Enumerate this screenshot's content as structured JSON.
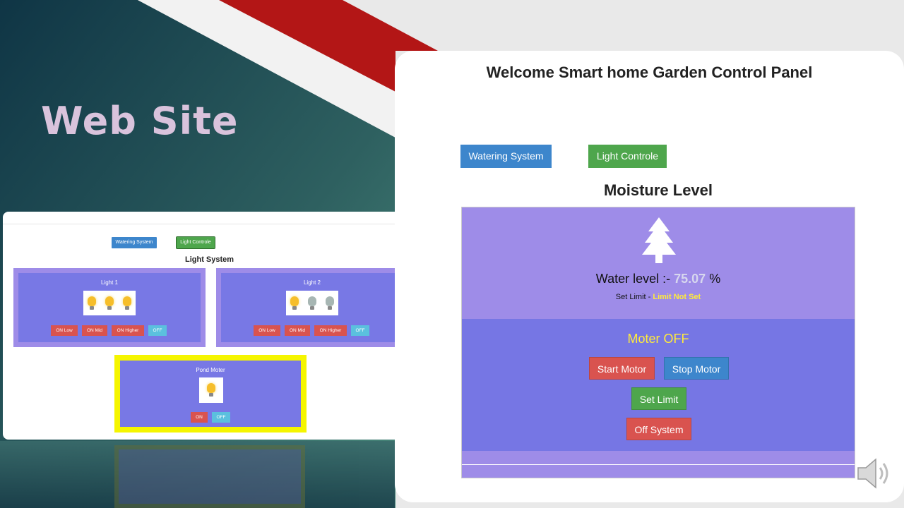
{
  "slide": {
    "title": "Web Site"
  },
  "left_preview": {
    "nav": {
      "watering": "Watering System",
      "light": "Light Controle"
    },
    "section_title": "Light System",
    "lights": [
      {
        "label": "Light 1",
        "bulbs": [
          "on",
          "on",
          "on"
        ],
        "buttons": [
          "ON Low",
          "ON Mid",
          "ON Higher",
          "OFF"
        ]
      },
      {
        "label": "Light 2",
        "bulbs": [
          "on",
          "off",
          "off"
        ],
        "buttons": [
          "ON Low",
          "ON Mid",
          "ON Higher",
          "OFF"
        ]
      }
    ],
    "pond": {
      "label": "Pond Moter",
      "buttons": [
        "ON",
        "OFF"
      ]
    }
  },
  "panel": {
    "title": "Welcome Smart home Garden Control Panel",
    "nav": {
      "watering": "Watering System",
      "light": "Light Controle"
    },
    "moisture_title": "Moisture Level",
    "water_level_prefix": "Water level :- ",
    "water_level_value": "75.07",
    "water_level_unit": " %",
    "set_limit_prefix": "Set Limit - ",
    "set_limit_value": "Limit Not Set",
    "motor_status": "Moter OFF",
    "buttons": {
      "start": "Start Motor",
      "stop": "Stop Motor",
      "set_limit": "Set Limit",
      "off_system": "Off System"
    }
  },
  "colors": {
    "accent_red": "#b71c1c",
    "teal_dark": "#123c4a",
    "card_purple": "#7878e5",
    "card_lilac": "#9e8ce8",
    "highlight_yellow": "#ffeb3b"
  }
}
